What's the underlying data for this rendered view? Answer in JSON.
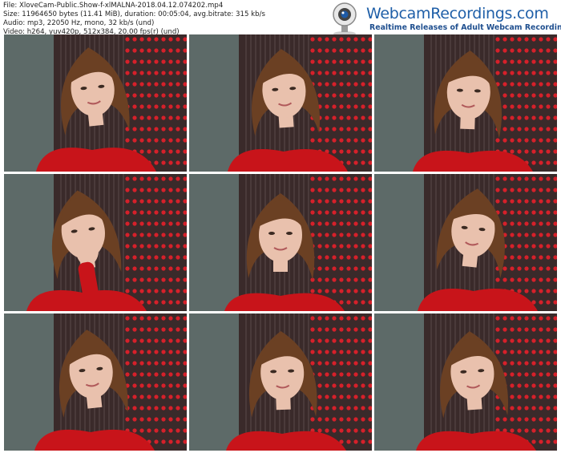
{
  "file_info": {
    "file": "File: XloveCam-Public.Show-f-xlMALNA-2018.04.12.074202.mp4",
    "size": "Size: 11964650 bytes (11.41 MiB), duration: 00:05:04, avg.bitrate: 315 kb/s",
    "audio": "Audio: mp3, 22050 Hz, mono, 32 kb/s (und)",
    "video": "Video: h264, yuv420p, 512x384, 20.00 fps(r) (und)"
  },
  "logo": {
    "title": "WebcamRecordings.com",
    "tagline": "Realtime Releases of Adult Webcam Recordings",
    "icon": "webcam-icon",
    "title_color": "#1f5fa8"
  },
  "thumbnails": [
    {
      "pose": "looking-left-smile"
    },
    {
      "pose": "looking-down-left"
    },
    {
      "pose": "smiling-down"
    },
    {
      "pose": "hand-at-mouth"
    },
    {
      "pose": "eyes-closed-smile"
    },
    {
      "pose": "looking-right"
    },
    {
      "pose": "looking-left-down"
    },
    {
      "pose": "looking-down"
    },
    {
      "pose": "smiling-down-left"
    }
  ],
  "colors": {
    "wall": "#6e7b79",
    "curtain": "#3a2a2a",
    "top": "#c8141a",
    "hair": "#6b4023",
    "skin": "#e9c1ad"
  }
}
